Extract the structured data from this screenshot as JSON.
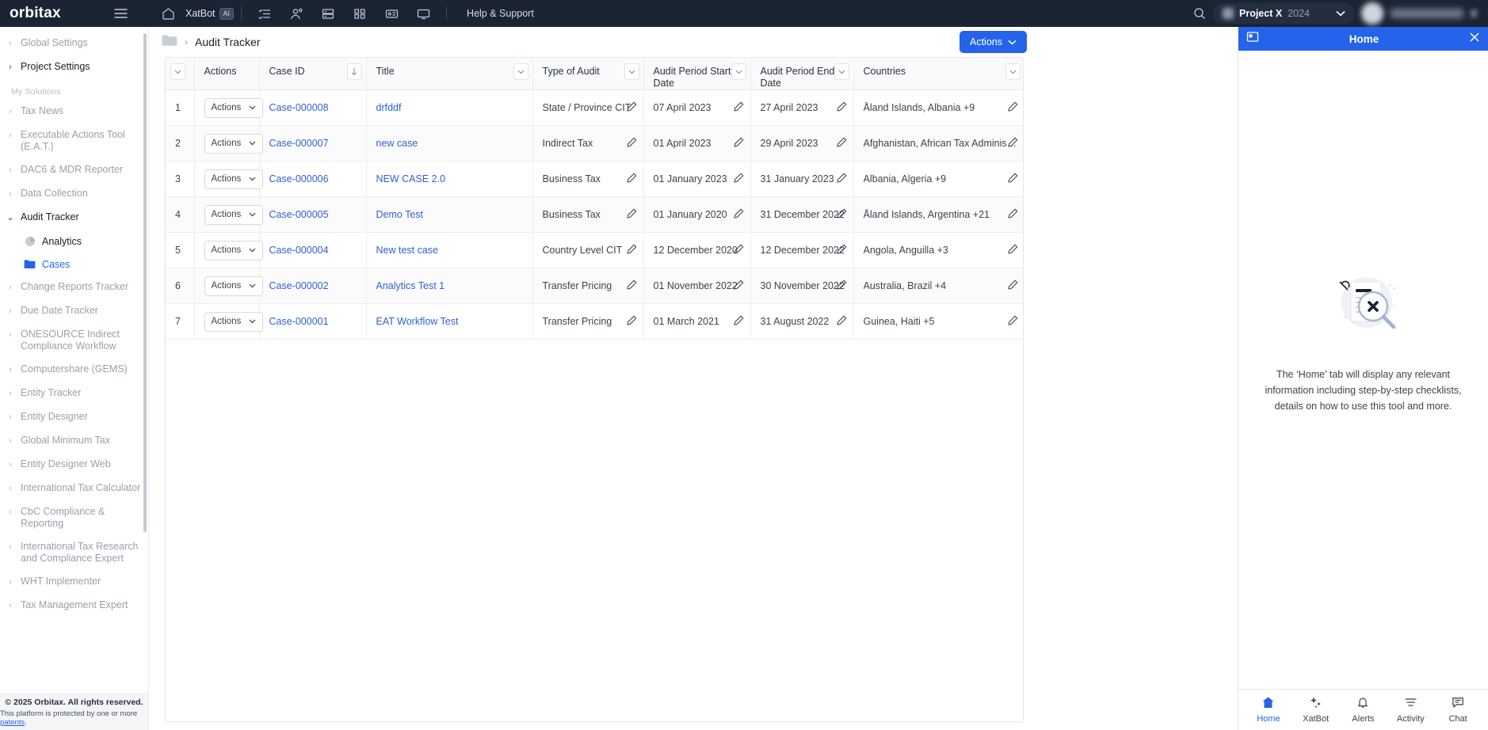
{
  "topbar": {
    "brand": "orbitax",
    "menu_icon": "hamburger-icon",
    "home_icon": "home-icon",
    "xatbot_label": "XatBot",
    "xatbot_badge": "AI",
    "help_label": "Help & Support",
    "search_icon": "search-icon",
    "project_name": "Project X",
    "project_year": "2024",
    "project_caret": "⌄",
    "icons": [
      "checklist-icon",
      "user-group-icon",
      "server-icon",
      "grid-icon",
      "id-card-icon",
      "monitor-icon"
    ]
  },
  "sidebar": {
    "top_items": [
      {
        "label": "Global Settings",
        "state": "collapsed",
        "emphasis": "muted"
      },
      {
        "label": "Project Settings",
        "state": "collapsed",
        "emphasis": "dark"
      }
    ],
    "section_label": "My Solutions",
    "items": [
      {
        "label": "Tax News",
        "state": "collapsed"
      },
      {
        "label": "Executable Actions Tool (E.A.T.)",
        "state": "collapsed"
      },
      {
        "label": "DAC6 & MDR Reporter",
        "state": "collapsed"
      },
      {
        "label": "Data Collection",
        "state": "collapsed"
      },
      {
        "label": "Audit Tracker",
        "state": "expanded"
      },
      {
        "label": "Change Reports Tracker",
        "state": "collapsed"
      },
      {
        "label": "Due Date Tracker",
        "state": "collapsed"
      },
      {
        "label": "ONESOURCE Indirect Compliance Workflow",
        "state": "collapsed"
      },
      {
        "label": "Computershare (GEMS)",
        "state": "collapsed"
      },
      {
        "label": "Entity Tracker",
        "state": "collapsed"
      },
      {
        "label": "Entity Designer",
        "state": "collapsed"
      },
      {
        "label": "Global Minimum Tax",
        "state": "collapsed"
      },
      {
        "label": "Entity Designer Web",
        "state": "collapsed"
      },
      {
        "label": "International Tax Calculator",
        "state": "collapsed"
      },
      {
        "label": "CbC Compliance & Reporting",
        "state": "collapsed"
      },
      {
        "label": "International Tax Research and Compliance Expert",
        "state": "collapsed"
      },
      {
        "label": "WHT Implementer",
        "state": "collapsed"
      },
      {
        "label": "Tax Management Expert",
        "state": "collapsed"
      }
    ],
    "audit_tracker_children": [
      {
        "label": "Analytics",
        "icon": "analytics-icon",
        "selected": false
      },
      {
        "label": "Cases",
        "icon": "folder-icon",
        "selected": true
      }
    ],
    "footer": {
      "copyright": "© 2025 Orbitax. All rights reserved.",
      "protected_prefix": "This platform is protected by one or more ",
      "protected_link": "patents",
      "protected_suffix": "."
    }
  },
  "main": {
    "breadcrumb_icon": "folder-icon",
    "breadcrumb_separator": "›",
    "breadcrumb_title": "Audit Tracker",
    "actions_button": "Actions",
    "actions_caret": "⌄",
    "table": {
      "columns": [
        {
          "key": "index",
          "label": "",
          "filter": true
        },
        {
          "key": "actions",
          "label": "Actions",
          "filter": false
        },
        {
          "key": "case_id",
          "label": "Case ID",
          "sort": "asc"
        },
        {
          "key": "title",
          "label": "Title",
          "filter": true
        },
        {
          "key": "type_of_audit",
          "label": "Type of Audit",
          "filter": true
        },
        {
          "key": "start_date",
          "label": "Audit Period Start Date",
          "filter": true
        },
        {
          "key": "end_date",
          "label": "Audit Period End Date",
          "filter": true
        },
        {
          "key": "countries",
          "label": "Countries",
          "filter": true
        }
      ],
      "row_action_label": "Actions",
      "rows": [
        {
          "index": "1",
          "case_id": "Case-000008",
          "title": "drfddf",
          "type_of_audit": "State / Province CIT",
          "start_date": "07 April 2023",
          "end_date": "27 April 2023",
          "countries": "Åland Islands, Albania +9"
        },
        {
          "index": "2",
          "case_id": "Case-000007",
          "title": "new case",
          "type_of_audit": "Indirect Tax",
          "start_date": "01 April 2023",
          "end_date": "29 April 2023",
          "countries": "Afghanistan, African Tax Administrat..."
        },
        {
          "index": "3",
          "case_id": "Case-000006",
          "title": "NEW CASE 2.0",
          "type_of_audit": "Business Tax",
          "start_date": "01 January 2023",
          "end_date": "31 January 2023",
          "countries": "Albania, Algeria +9"
        },
        {
          "index": "4",
          "case_id": "Case-000005",
          "title": "Demo Test",
          "type_of_audit": "Business Tax",
          "start_date": "01 January 2020",
          "end_date": "31 December 2022",
          "countries": "Åland Islands, Argentina +21"
        },
        {
          "index": "5",
          "case_id": "Case-000004",
          "title": "New test case",
          "type_of_audit": "Country Level CIT",
          "start_date": "12 December 2020",
          "end_date": "12 December 2022",
          "countries": "Angola, Anguilla +3"
        },
        {
          "index": "6",
          "case_id": "Case-000002",
          "title": "Analytics Test 1",
          "type_of_audit": "Transfer Pricing",
          "start_date": "01 November 2022",
          "end_date": "30 November 2022",
          "countries": "Australia, Brazil +4"
        },
        {
          "index": "7",
          "case_id": "Case-000001",
          "title": "EAT Workflow Test",
          "type_of_audit": "Transfer Pricing",
          "start_date": "01 March 2021",
          "end_date": "31 August 2022",
          "countries": "Guinea, Haiti +5"
        }
      ]
    }
  },
  "right_panel": {
    "panel_icon": "panel-collapse-icon",
    "title": "Home",
    "close_icon": "close-icon",
    "illustration": "empty-search-illustration",
    "empty_text": "The ‘Home’ tab will display any relevant information including step-by-step checklists, details on how to use this tool and more.",
    "nav": [
      {
        "label": "Home",
        "icon": "home-icon",
        "active": true
      },
      {
        "label": "XatBot",
        "icon": "sparkle-icon",
        "active": false
      },
      {
        "label": "Alerts",
        "icon": "bell-icon",
        "active": false
      },
      {
        "label": "Activity",
        "icon": "activity-lines-icon",
        "active": false
      },
      {
        "label": "Chat",
        "icon": "chat-icon",
        "active": false
      }
    ]
  },
  "colors": {
    "topbar_bg": "#1b2433",
    "accent_blue": "#2563eb",
    "link_blue": "#2f5fd6",
    "text_dark": "#1a1f29",
    "text_muted": "#9aa0ab",
    "border": "#e5e7eb"
  }
}
